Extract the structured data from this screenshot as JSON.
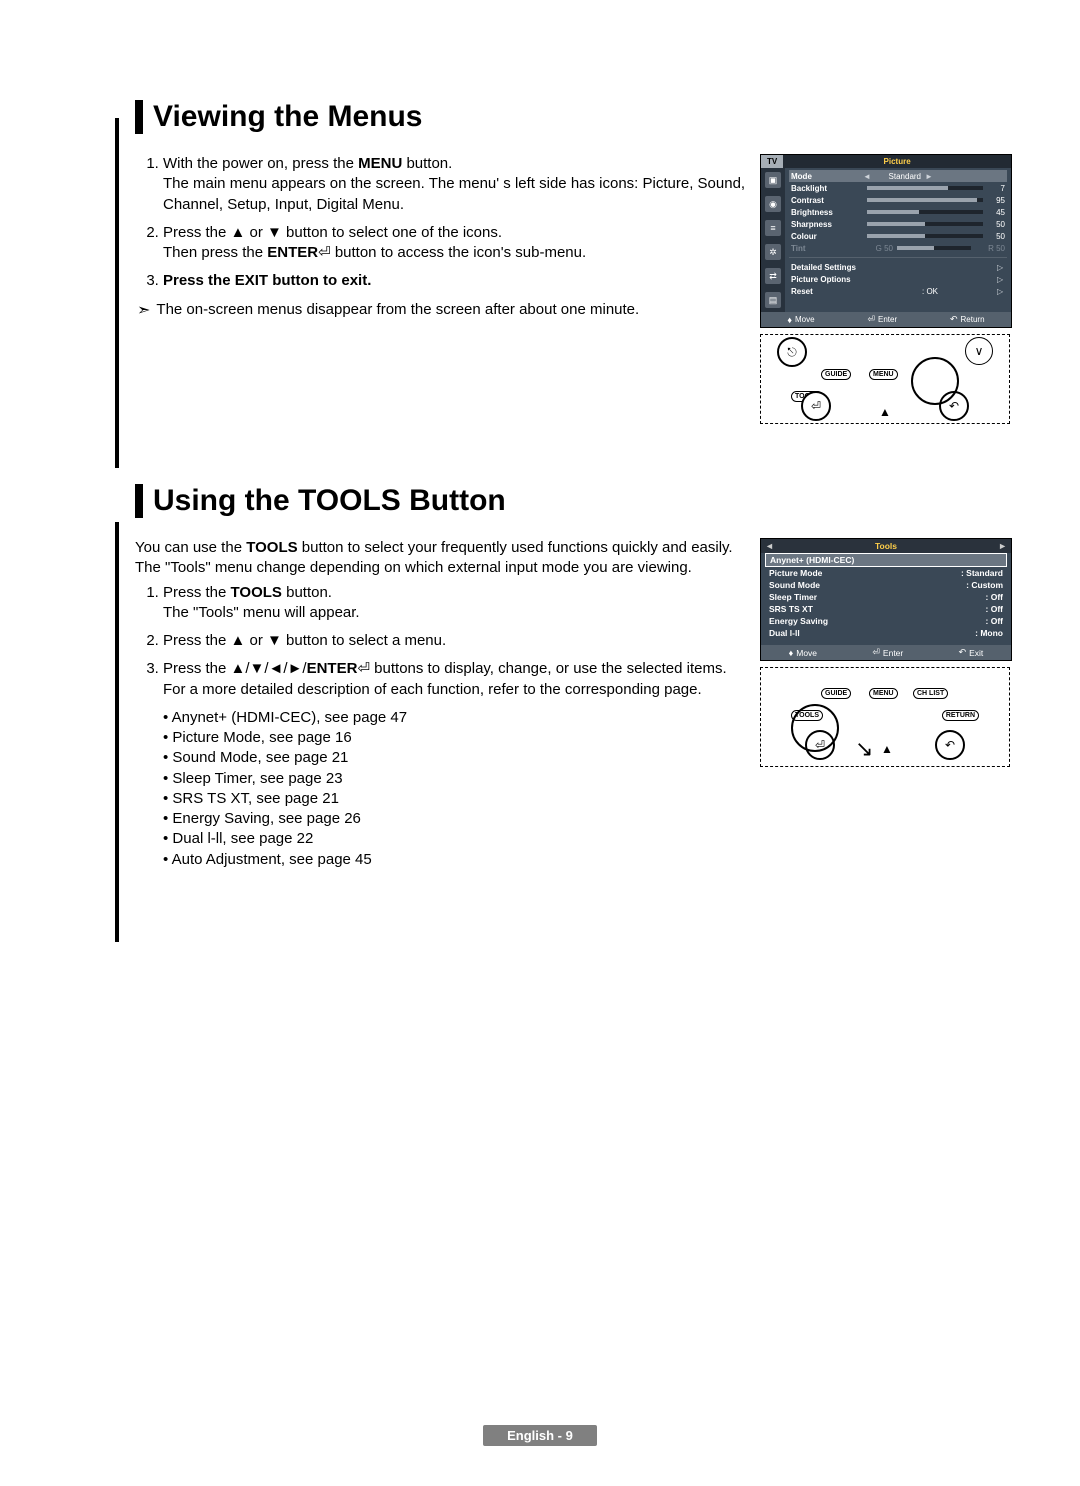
{
  "section1": {
    "title": "Viewing the Menus",
    "steps": {
      "s1a": "With the power on, press the ",
      "s1b": "MENU",
      "s1c": " button.",
      "s1d": "The main menu appears on the screen. The menu' s left side has icons: Picture, Sound, Channel, Setup, Input, Digital Menu.",
      "s2a": "Press the ▲ or ▼ button to select one of the icons.",
      "s2b": "Then press the ",
      "s2c": "ENTER",
      "s2d": " button to access the icon's sub-menu.",
      "s3a": "Press the ",
      "s3b": "EXIT",
      "s3c": " button to exit."
    },
    "note": "The on-screen menus disappear from the screen after about one minute."
  },
  "osd": {
    "tv": "TV",
    "title": "Picture",
    "rows": {
      "mode": {
        "label": "Mode",
        "val": "Standard"
      },
      "backlight": {
        "label": "Backlight",
        "num": "7"
      },
      "contrast": {
        "label": "Contrast",
        "num": "95"
      },
      "brightness": {
        "label": "Brightness",
        "num": "45"
      },
      "sharpness": {
        "label": "Sharpness",
        "num": "50"
      },
      "colour": {
        "label": "Colour",
        "num": "50"
      },
      "tint": {
        "label": "Tint",
        "g": "G 50",
        "r": "R 50"
      },
      "detailed": {
        "label": "Detailed Settings"
      },
      "picopt": {
        "label": "Picture Options"
      },
      "reset": {
        "label": "Reset",
        "val": "OK"
      }
    },
    "footer": {
      "move": "Move",
      "enter": "Enter",
      "return": "Return"
    }
  },
  "remote1": {
    "guide": "GUIDE",
    "menu": "MENU",
    "tools": "TOOLS"
  },
  "section2": {
    "title": "Using the TOOLS Button",
    "intro_a": "You can use the ",
    "intro_b": "TOOLS",
    "intro_c": " button to select your frequently used functions quickly and easily. The \"Tools\" menu change depending on which external input mode you are viewing.",
    "s1a": "Press the ",
    "s1b": "TOOLS",
    "s1c": " button.",
    "s1d": "The \"Tools\" menu will appear.",
    "s2": "Press the ▲ or ▼ button to select a menu.",
    "s3a": "Press the ▲/▼/◄/►/",
    "s3b": "ENTER",
    "s3c": " buttons to display, change, or use the selected items. For a more detailed description of each function, refer to the corresponding page.",
    "bullets": [
      "Anynet+ (HDMI-CEC), see page 47",
      "Picture Mode, see page 16",
      "Sound Mode, see page 21",
      "Sleep Timer, see page 23",
      "SRS TS XT, see page 21",
      "Energy Saving, see page 26",
      "Dual l-ll, see page 22",
      "Auto Adjustment, see page 45"
    ]
  },
  "tosd": {
    "title": "Tools",
    "rows": [
      {
        "label": "Anynet+ (HDMI-CEC)",
        "val": "",
        "sel": true
      },
      {
        "label": "Picture Mode",
        "val": "Standard"
      },
      {
        "label": "Sound Mode",
        "val": "Custom"
      },
      {
        "label": "Sleep Timer",
        "val": "Off"
      },
      {
        "label": "SRS TS XT",
        "val": "Off"
      },
      {
        "label": "Energy Saving",
        "val": "Off"
      },
      {
        "label": "Dual l-ll",
        "val": "Mono"
      }
    ],
    "footer": {
      "move": "Move",
      "enter": "Enter",
      "exit": "Exit"
    }
  },
  "remote2": {
    "guide": "GUIDE",
    "menu": "MENU",
    "chlist": "CH LIST",
    "tools": "TOOLS",
    "return": "RETURN"
  },
  "footer": "English - 9"
}
